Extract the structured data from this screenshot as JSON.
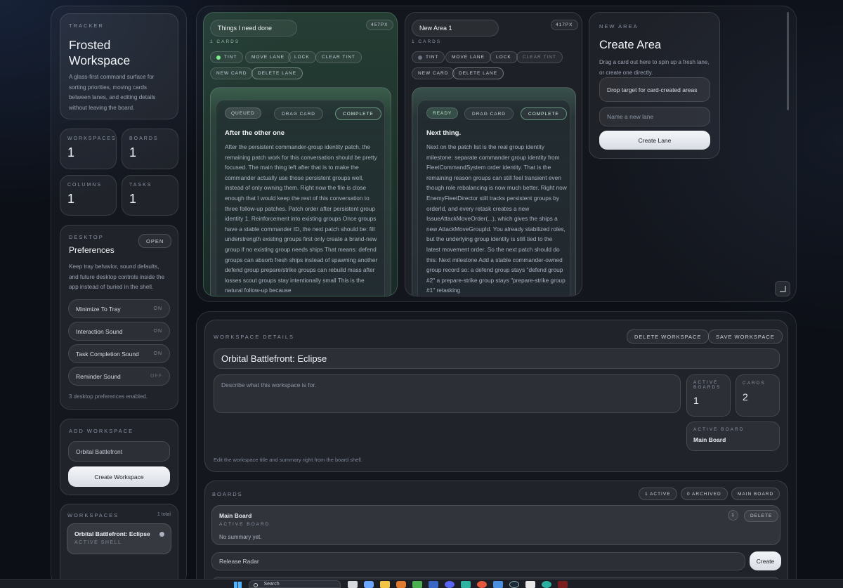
{
  "sidebar": {
    "tracker_eyebrow": "TRACKER",
    "title_line1": "Frosted",
    "title_line2": "Workspace",
    "description": "A glass-first command surface for sorting priorities, moving cards between lanes, and editing details without leaving the board.",
    "stats": [
      {
        "label": "WORKSPACES",
        "value": "1"
      },
      {
        "label": "BOARDS",
        "value": "1"
      },
      {
        "label": "COLUMNS",
        "value": "1"
      },
      {
        "label": "TASKS",
        "value": "1"
      }
    ],
    "desktop": {
      "eyebrow": "DESKTOP",
      "title": "Preferences",
      "open_label": "OPEN",
      "description": "Keep tray behavior, sound defaults, and future desktop controls inside the app instead of buried in the shell.",
      "toggles": [
        {
          "label": "Minimize To Tray",
          "state": "ON"
        },
        {
          "label": "Interaction Sound",
          "state": "ON"
        },
        {
          "label": "Task Completion Sound",
          "state": "ON"
        },
        {
          "label": "Reminder Sound",
          "state": "OFF"
        }
      ],
      "footer": "3 desktop preferences enabled."
    },
    "add_workspace": {
      "eyebrow": "ADD WORKSPACE",
      "input_value": "Orbital Battlefront",
      "button": "Create Workspace"
    },
    "workspaces": {
      "eyebrow": "WORKSPACES",
      "count": "1 total",
      "item_name": "Orbital Battlefront: Eclipse",
      "item_sub": "ACTIVE SHELL"
    }
  },
  "lanes": [
    {
      "title": "Things I need done",
      "width_badge": "457PX",
      "count": "1 CARDS",
      "buttons": {
        "tint": "TINT",
        "move": "MOVE LANE",
        "lock": "LOCK",
        "clear": "CLEAR TINT",
        "new_card": "NEW CARD",
        "delete": "DELETE LANE"
      },
      "card": {
        "status": "QUEUED",
        "drag": "DRAG CARD",
        "complete": "COMPLETE",
        "title": "After the other one",
        "body": "After the persistent commander-group identity patch, the remaining patch work for this conversation should be pretty focused. The main thing left after that is to make the commander actually use those persistent groups well, instead of only owning them. Right now the file is close enough that I would keep the rest of this conversation to three follow-up patches. Patch order after persistent group identity 1. Reinforcement into existing groups Once groups have a stable commander ID, the next patch should be: fill understrength existing groups first only create a brand-new group if no existing group needs ships That means: defend groups can absorb fresh ships instead of spawning another defend group prepare/strike groups can rebuild mass after losses scout groups stay intentionally small This is the natural follow-up because"
      }
    },
    {
      "title": "New Area 1",
      "width_badge": "417PX",
      "count": "1 CARDS",
      "buttons": {
        "tint": "TINT",
        "move": "MOVE LANE",
        "lock": "LOCK",
        "clear": "CLEAR TINT",
        "new_card": "NEW CARD",
        "delete": "DELETE LANE"
      },
      "card": {
        "status": "READY",
        "drag": "DRAG CARD",
        "complete": "COMPLETE",
        "title": "Next thing.",
        "body": "Next on the patch list is the real group identity milestone: separate commander group identity from FleetCommandSystem order identity. That is the remaining reason groups can still feel transient even though role rebalancing is now much better. Right now EnemyFleetDirector still tracks persistent groups by orderId, and every retask creates a new IssueAttackMoveOrder(...), which gives the ships a new AttackMoveGroupId. You already stabilized roles, but the underlying group identity is still tied to the latest movement order. So the next patch should do this: Next milestone Add a stable commander-owned group record so: a defend group stays \"defend group #2\" a prepare-strike group stays \"prepare-strike group #1\" retasking"
      }
    }
  ],
  "new_area": {
    "eyebrow": "NEW AREA",
    "title": "Create Area",
    "description": "Drag a card out here to spin up a fresh lane, or create one directly.",
    "drop_target": "Drop target for card-created areas",
    "name_placeholder": "Name a new lane",
    "button": "Create Lane"
  },
  "details": {
    "eyebrow": "WORKSPACE DETAILS",
    "delete_label": "DELETE WORKSPACE",
    "save_label": "SAVE WORKSPACE",
    "title_value": "Orbital Battlefront: Eclipse",
    "desc_placeholder": "Describe what this workspace is for.",
    "active_boards_label_1": "ACTIVE",
    "active_boards_label_2": "BOARDS",
    "active_boards_value": "1",
    "cards_label": "CARDS",
    "cards_value": "2",
    "active_board_label": "ACTIVE BOARD",
    "active_board_value": "Main Board",
    "hint": "Edit the workspace title and summary right from the board shell."
  },
  "boards": {
    "eyebrow": "BOARDS",
    "active_pill": "1 ACTIVE",
    "archived_pill": "0 ARCHIVED",
    "main_pill": "MAIN BOARD",
    "item_name": "Main Board",
    "item_sub": "ACTIVE BOARD",
    "item_count": "1",
    "item_delete": "DELETE",
    "item_summary": "No summary yet.",
    "new_input_value": "Release Radar",
    "create_button": "Create"
  },
  "taskbar": {
    "search_label": "Search"
  }
}
